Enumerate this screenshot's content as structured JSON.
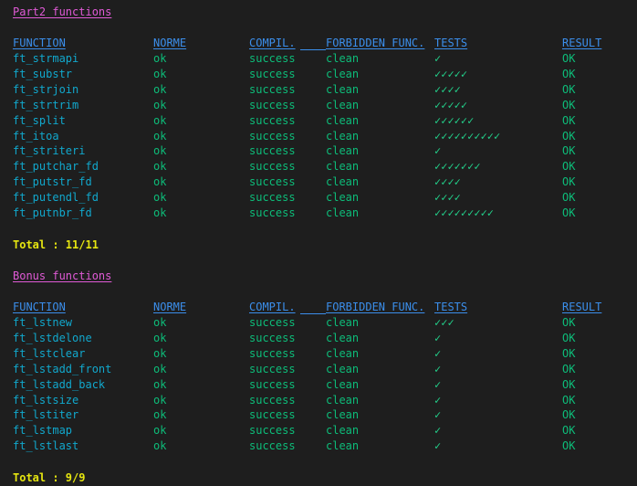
{
  "colors": {
    "background": "#1e1e1e",
    "section_title": "#e05ad6",
    "header": "#3b8eea",
    "function_name": "#11a8cd",
    "ok_value": "#0dbc79",
    "total": "#e5e510"
  },
  "part2": {
    "title": "Part2 functions",
    "headers": {
      "function": "FUNCTION",
      "norme": "NORME",
      "compil": "COMPIL.",
      "forbidden": "FORBIDDEN FUNC.",
      "tests": "TESTS",
      "result": "RESULT"
    },
    "rows": [
      {
        "fn": "ft_strmapi",
        "norme": "ok",
        "compil": "success",
        "forbidden": "clean",
        "tests": "✓",
        "result": "OK"
      },
      {
        "fn": "ft_substr",
        "norme": "ok",
        "compil": "success",
        "forbidden": "clean",
        "tests": "✓✓✓✓✓",
        "result": "OK"
      },
      {
        "fn": "ft_strjoin",
        "norme": "ok",
        "compil": "success",
        "forbidden": "clean",
        "tests": "✓✓✓✓",
        "result": "OK"
      },
      {
        "fn": "ft_strtrim",
        "norme": "ok",
        "compil": "success",
        "forbidden": "clean",
        "tests": "✓✓✓✓✓",
        "result": "OK"
      },
      {
        "fn": "ft_split",
        "norme": "ok",
        "compil": "success",
        "forbidden": "clean",
        "tests": "✓✓✓✓✓✓",
        "result": "OK"
      },
      {
        "fn": "ft_itoa",
        "norme": "ok",
        "compil": "success",
        "forbidden": "clean",
        "tests": "✓✓✓✓✓✓✓✓✓✓",
        "result": "OK"
      },
      {
        "fn": "ft_striteri",
        "norme": "ok",
        "compil": "success",
        "forbidden": "clean",
        "tests": "✓",
        "result": "OK"
      },
      {
        "fn": "ft_putchar_fd",
        "norme": "ok",
        "compil": "success",
        "forbidden": "clean",
        "tests": "✓✓✓✓✓✓✓",
        "result": "OK"
      },
      {
        "fn": "ft_putstr_fd",
        "norme": "ok",
        "compil": "success",
        "forbidden": "clean",
        "tests": "✓✓✓✓",
        "result": "OK"
      },
      {
        "fn": "ft_putendl_fd",
        "norme": "ok",
        "compil": "success",
        "forbidden": "clean",
        "tests": "✓✓✓✓",
        "result": "OK"
      },
      {
        "fn": "ft_putnbr_fd",
        "norme": "ok",
        "compil": "success",
        "forbidden": "clean",
        "tests": "✓✓✓✓✓✓✓✓✓",
        "result": "OK"
      }
    ],
    "total": "Total : 11/11"
  },
  "bonus": {
    "title": "Bonus functions",
    "headers": {
      "function": "FUNCTION",
      "norme": "NORME",
      "compil": "COMPIL.",
      "forbidden": "FORBIDDEN FUNC.",
      "tests": "TESTS",
      "result": "RESULT"
    },
    "rows": [
      {
        "fn": "ft_lstnew",
        "norme": "ok",
        "compil": "success",
        "forbidden": "clean",
        "tests": "✓✓✓",
        "result": "OK"
      },
      {
        "fn": "ft_lstdelone",
        "norme": "ok",
        "compil": "success",
        "forbidden": "clean",
        "tests": "✓",
        "result": "OK"
      },
      {
        "fn": "ft_lstclear",
        "norme": "ok",
        "compil": "success",
        "forbidden": "clean",
        "tests": "✓",
        "result": "OK"
      },
      {
        "fn": "ft_lstadd_front",
        "norme": "ok",
        "compil": "success",
        "forbidden": "clean",
        "tests": "✓",
        "result": "OK"
      },
      {
        "fn": "ft_lstadd_back",
        "norme": "ok",
        "compil": "success",
        "forbidden": "clean",
        "tests": "✓",
        "result": "OK"
      },
      {
        "fn": "ft_lstsize",
        "norme": "ok",
        "compil": "success",
        "forbidden": "clean",
        "tests": "✓",
        "result": "OK"
      },
      {
        "fn": "ft_lstiter",
        "norme": "ok",
        "compil": "success",
        "forbidden": "clean",
        "tests": "✓",
        "result": "OK"
      },
      {
        "fn": "ft_lstmap",
        "norme": "ok",
        "compil": "success",
        "forbidden": "clean",
        "tests": "✓",
        "result": "OK"
      },
      {
        "fn": "ft_lstlast",
        "norme": "ok",
        "compil": "success",
        "forbidden": "clean",
        "tests": "✓",
        "result": "OK"
      }
    ],
    "total": "Total : 9/9"
  }
}
